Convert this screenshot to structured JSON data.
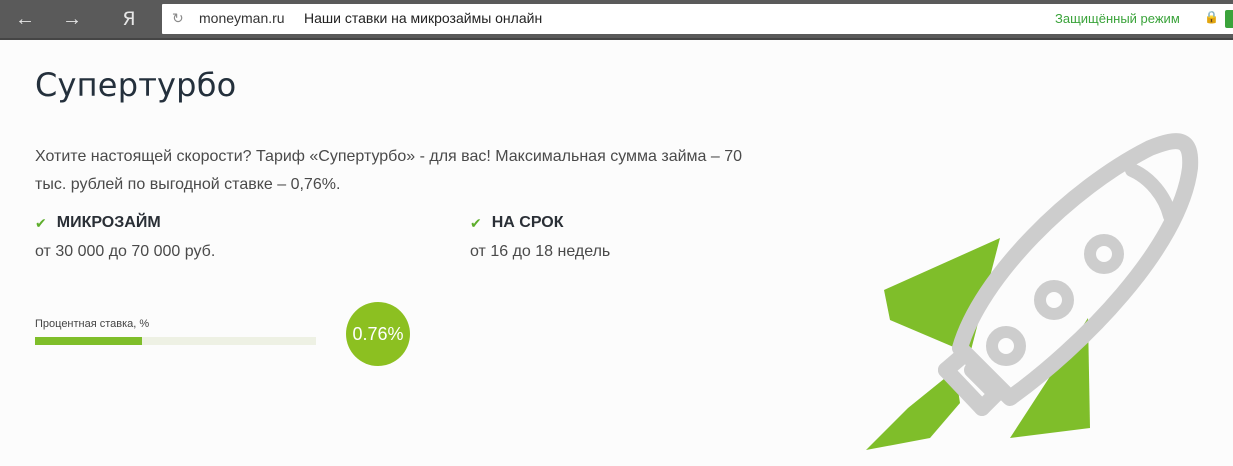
{
  "browser": {
    "back_icon": "←",
    "forward_icon": "→",
    "yandex_label": "Я",
    "reload_icon": "↻",
    "domain": "moneyman.ru",
    "page_title": "Наши ставки на микрозаймы онлайн",
    "secure_label": "Защищённый режим",
    "lock_icon": "🔒"
  },
  "content": {
    "title": "Супертурбо",
    "description": "Хотите настоящей скорости? Тариф «Супертурбо» - для вас! Максимальная сумма займа – 70 тыс. рублей по выгодной ставке – 0,76%.",
    "features": [
      {
        "check": "✔",
        "title": "МИКРОЗАЙМ",
        "value": "от 30 000 до 70 000 руб."
      },
      {
        "check": "✔",
        "title": "НА СРОК",
        "value": "от 16 до 18 недель"
      }
    ],
    "rate": {
      "label": "Процентная ставка, %",
      "value_text": "0.76%",
      "fill_fraction": 0.38
    }
  },
  "colors": {
    "accent_green": "#8cc021",
    "secure_green": "#3aa33a",
    "rocket_gray": "#cfcfcf"
  }
}
